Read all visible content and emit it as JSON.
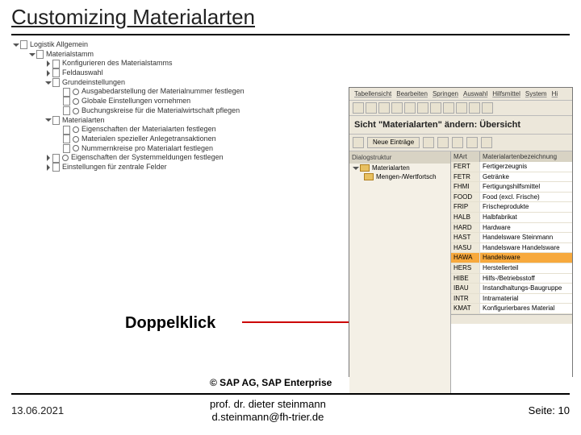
{
  "title": "Customizing Materialarten",
  "tree": {
    "r0": "Logistik Allgemein",
    "r1": "Materialstamm",
    "r2": "Konfigurieren des Materialstamms",
    "r3": "Feldauswahl",
    "r4": "Grundeinstellungen",
    "r5": "Ausgabedarstellung der Materialnummer festlegen",
    "r6": "Globale Einstellungen vornehmen",
    "r7": "Buchungskreise für die Materialwirtschaft pflegen",
    "r8": "Materialarten",
    "r9": "Eigenschaften der Materialarten festlegen",
    "r10": "Materialen spezieller Anlegetransaktionen",
    "r11": "Nummernkreise pro Materialart festlegen",
    "r12": "Eigenschaften der Systemmeldungen festlegen",
    "r13": "Einstellungen für zentrale Felder"
  },
  "doppelklick": "Doppelklick",
  "sap": {
    "menu": [
      "Tabellensicht",
      "Bearbeiten",
      "Springen",
      "Auswahl",
      "Hilfsmittel",
      "System",
      "Hi"
    ],
    "heading": "Sicht \"Materialarten\" ändern: Übersicht",
    "neulabel": "Neue Einträge",
    "dlg_header": "Dialogstruktur",
    "dlg_row1": "Materialarten",
    "dlg_row2": "Mengen-/Wertfortsch",
    "grid_h1": "MArt",
    "grid_h2": "Materialartenbezeichnung",
    "rows": [
      {
        "c1": "FERT",
        "c2": "Fertigerzeugnis"
      },
      {
        "c1": "FETR",
        "c2": "Getränke"
      },
      {
        "c1": "FHMI",
        "c2": "Fertigungshilfsmittel"
      },
      {
        "c1": "FOOD",
        "c2": "Food (excl. Frische)"
      },
      {
        "c1": "FRIP",
        "c2": "Frischeprodukte"
      },
      {
        "c1": "HALB",
        "c2": "Halbfabrikat"
      },
      {
        "c1": "HARD",
        "c2": "Hardware"
      },
      {
        "c1": "HAST",
        "c2": "Handelsware Steinmann"
      },
      {
        "c1": "HASU",
        "c2": "Handelsware Handelsware"
      },
      {
        "c1": "HAWA",
        "c2": "Handelsware"
      },
      {
        "c1": "HERS",
        "c2": "Herstellerteil"
      },
      {
        "c1": "HIBE",
        "c2": "Hilfs-/Betriebsstoff"
      },
      {
        "c1": "IBAU",
        "c2": "Instandhaltungs-Baugruppe"
      },
      {
        "c1": "INTR",
        "c2": "Intramaterial"
      },
      {
        "c1": "KMAT",
        "c2": "Konfigurierbares Material"
      }
    ]
  },
  "footer": {
    "copyright": "© SAP AG, SAP Enterprise",
    "date": "13.06.2021",
    "prof1": "prof. dr. dieter steinmann",
    "prof2": "d.steinmann@fh-trier.de",
    "seite": "Seite: 10"
  }
}
